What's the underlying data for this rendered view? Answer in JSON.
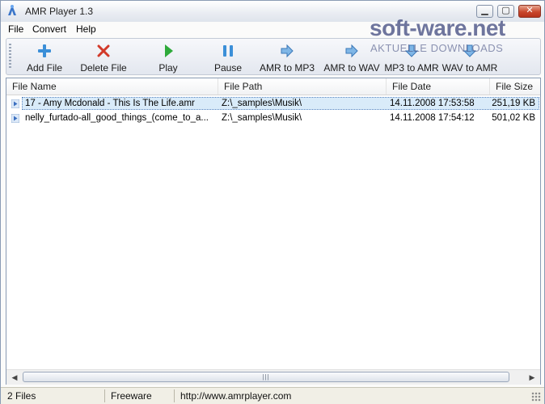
{
  "window": {
    "title": "AMR Player 1.3"
  },
  "menu": [
    "File",
    "Convert",
    "Help"
  ],
  "watermark": {
    "main": "soft-ware.net",
    "sub": "AKTUELLE DOWNLOADS"
  },
  "toolbar": {
    "add_file": "Add File",
    "delete_file": "Delete File",
    "play": "Play",
    "pause": "Pause",
    "amr_to_mp3": "AMR to MP3",
    "amr_to_wav": "AMR to WAV",
    "mp3_to_amr": "MP3 to AMR",
    "wav_to_amr": "WAV to AMR"
  },
  "list": {
    "columns": [
      "File Name",
      "File Path",
      "File Date",
      "File Size"
    ],
    "rows": [
      {
        "name": "17 - Amy Mcdonald - This Is The Life.amr",
        "path": "Z:\\_samples\\Musik\\",
        "date": "14.11.2008 17:53:58",
        "size": "251,19 KB"
      },
      {
        "name": "nelly_furtado-all_good_things_(come_to_a...",
        "path": "Z:\\_samples\\Musik\\",
        "date": "14.11.2008 17:54:12",
        "size": "501,02 KB"
      }
    ]
  },
  "status": {
    "count": "2 Files",
    "license": "Freeware",
    "url": "http://www.amrplayer.com"
  },
  "colors": {
    "accent_blue": "#3b8fd8",
    "delete_red": "#d23a2a",
    "play_green": "#2eaa3a",
    "selection": "#d9ebf9"
  }
}
